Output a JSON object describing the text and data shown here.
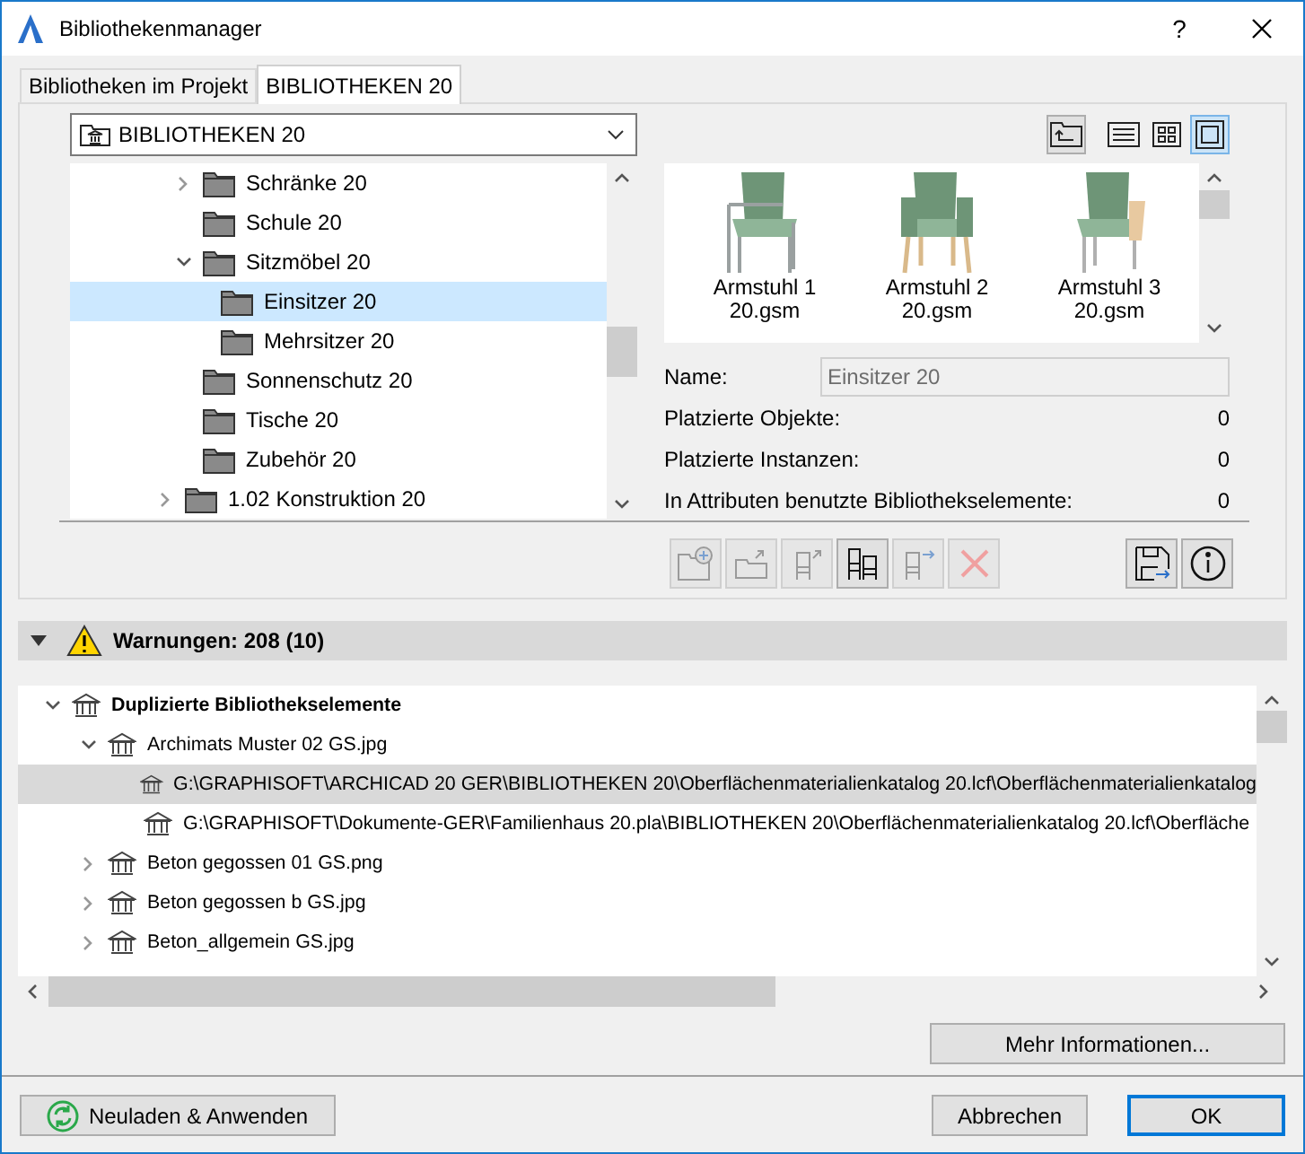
{
  "window": {
    "title": "Bibliothekenmanager",
    "help": "?"
  },
  "tabs": [
    {
      "label": "Bibliotheken im Projekt",
      "selected": false
    },
    {
      "label": "BIBLIOTHEKEN 20",
      "selected": true
    }
  ],
  "library_dropdown": {
    "value": "BIBLIOTHEKEN 20"
  },
  "view_buttons": [
    {
      "kind": "up",
      "selected": false
    },
    {
      "kind": "list",
      "selected": false
    },
    {
      "kind": "grid",
      "selected": false
    },
    {
      "kind": "single",
      "selected": true
    }
  ],
  "folder_tree": {
    "items": [
      {
        "label": "Schränke 20",
        "expanded": false,
        "selected": false
      },
      {
        "label": "Schule 20",
        "selected": false
      },
      {
        "label": "Sitzmöbel 20",
        "expanded": true,
        "selected": false,
        "children": [
          {
            "label": "Einsitzer 20",
            "selected": true
          },
          {
            "label": "Mehrsitzer 20",
            "selected": false
          }
        ]
      },
      {
        "label": "Sonnenschutz 20",
        "selected": false
      },
      {
        "label": "Tische 20",
        "selected": false
      },
      {
        "label": "Zubehör 20",
        "selected": false
      }
    ],
    "parent_level_items": [
      {
        "label": "1.02 Konstruktion 20",
        "expanded": false,
        "selected": false
      }
    ]
  },
  "previews": [
    {
      "kind": "metal",
      "name": "Armstuhl 1 20.gsm"
    },
    {
      "kind": "wood",
      "name": "Armstuhl 2 20.gsm"
    },
    {
      "kind": "panel",
      "name": "Armstuhl 3 20.gsm"
    }
  ],
  "details": {
    "name_label": "Name:",
    "name_value": "Einsitzer 20",
    "rows": [
      {
        "label": "Platzierte Objekte:",
        "value": "0"
      },
      {
        "label": "Platzierte Instanzen:",
        "value": "0"
      },
      {
        "label": "In Attributen benutzte Bibliothekselemente:",
        "value": "0"
      }
    ]
  },
  "tool_buttons": [
    {
      "kind": "new-folder",
      "disabled": true
    },
    {
      "kind": "export-folder",
      "disabled": true
    },
    {
      "kind": "export-object",
      "disabled": true
    },
    {
      "kind": "objects",
      "disabled": false
    },
    {
      "kind": "move-object",
      "disabled": true
    },
    {
      "kind": "delete",
      "disabled": true
    }
  ],
  "side_buttons": [
    {
      "kind": "save"
    },
    {
      "kind": "info"
    }
  ],
  "warnings": {
    "title": "Warnungen: 208 (10)",
    "expanded": true,
    "items": [
      {
        "label": "Duplizierte Bibliothekselemente",
        "expanded": true,
        "selected": false,
        "children": [
          {
            "label": "Archimats Muster 02 GS.jpg",
            "expanded": true,
            "selected": false,
            "children": [
              {
                "label": "G:\\GRAPHISOFT\\ARCHICAD 20 GER\\BIBLIOTHEKEN 20\\Oberflächenmaterialienkatalog 20.lcf\\Oberflächenmaterialienkatalog",
                "selected": true
              },
              {
                "label": "G:\\GRAPHISOFT\\Dokumente-GER\\Familienhaus 20.pla\\BIBLIOTHEKEN 20\\Oberflächenmaterialienkatalog 20.lcf\\Oberfläche",
                "selected": false
              }
            ]
          },
          {
            "label": "Beton gegossen 01 GS.png",
            "expanded": false,
            "selected": false
          },
          {
            "label": "Beton gegossen b GS.jpg",
            "expanded": false,
            "selected": false
          },
          {
            "label": "Beton_allgemein GS.jpg",
            "expanded": false,
            "selected": false
          }
        ]
      }
    ]
  },
  "more_info_button": "Mehr Informationen...",
  "reload_button": "Neuladen & Anwenden",
  "cancel_button": "Abbrechen",
  "ok_button": "OK"
}
